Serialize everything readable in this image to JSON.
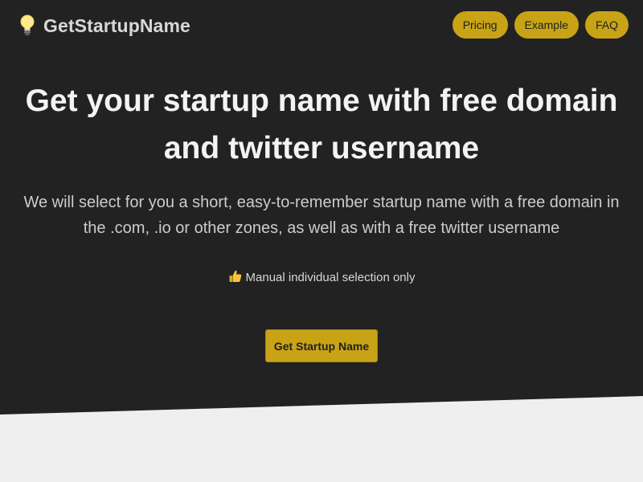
{
  "colors": {
    "hero_background": "#222222",
    "page_background": "#efefef",
    "accent": "#c9a316",
    "title_text": "#f3f3f3",
    "body_text": "#c9ccd0"
  },
  "header": {
    "logo_icon": "lightbulb-icon",
    "brand": "GetStartupName",
    "nav": [
      "Pricing",
      "Example",
      "FAQ"
    ]
  },
  "hero": {
    "title": "Get your startup name with free domain and twitter username",
    "subtitle": "We will select for you a short, easy-to-remember startup name with a free domain in the .com, .io or other zones, as well as with a free twitter username",
    "note_icon": "thumbs-up-icon",
    "note": "Manual individual selection only",
    "cta": "Get Startup Name"
  }
}
